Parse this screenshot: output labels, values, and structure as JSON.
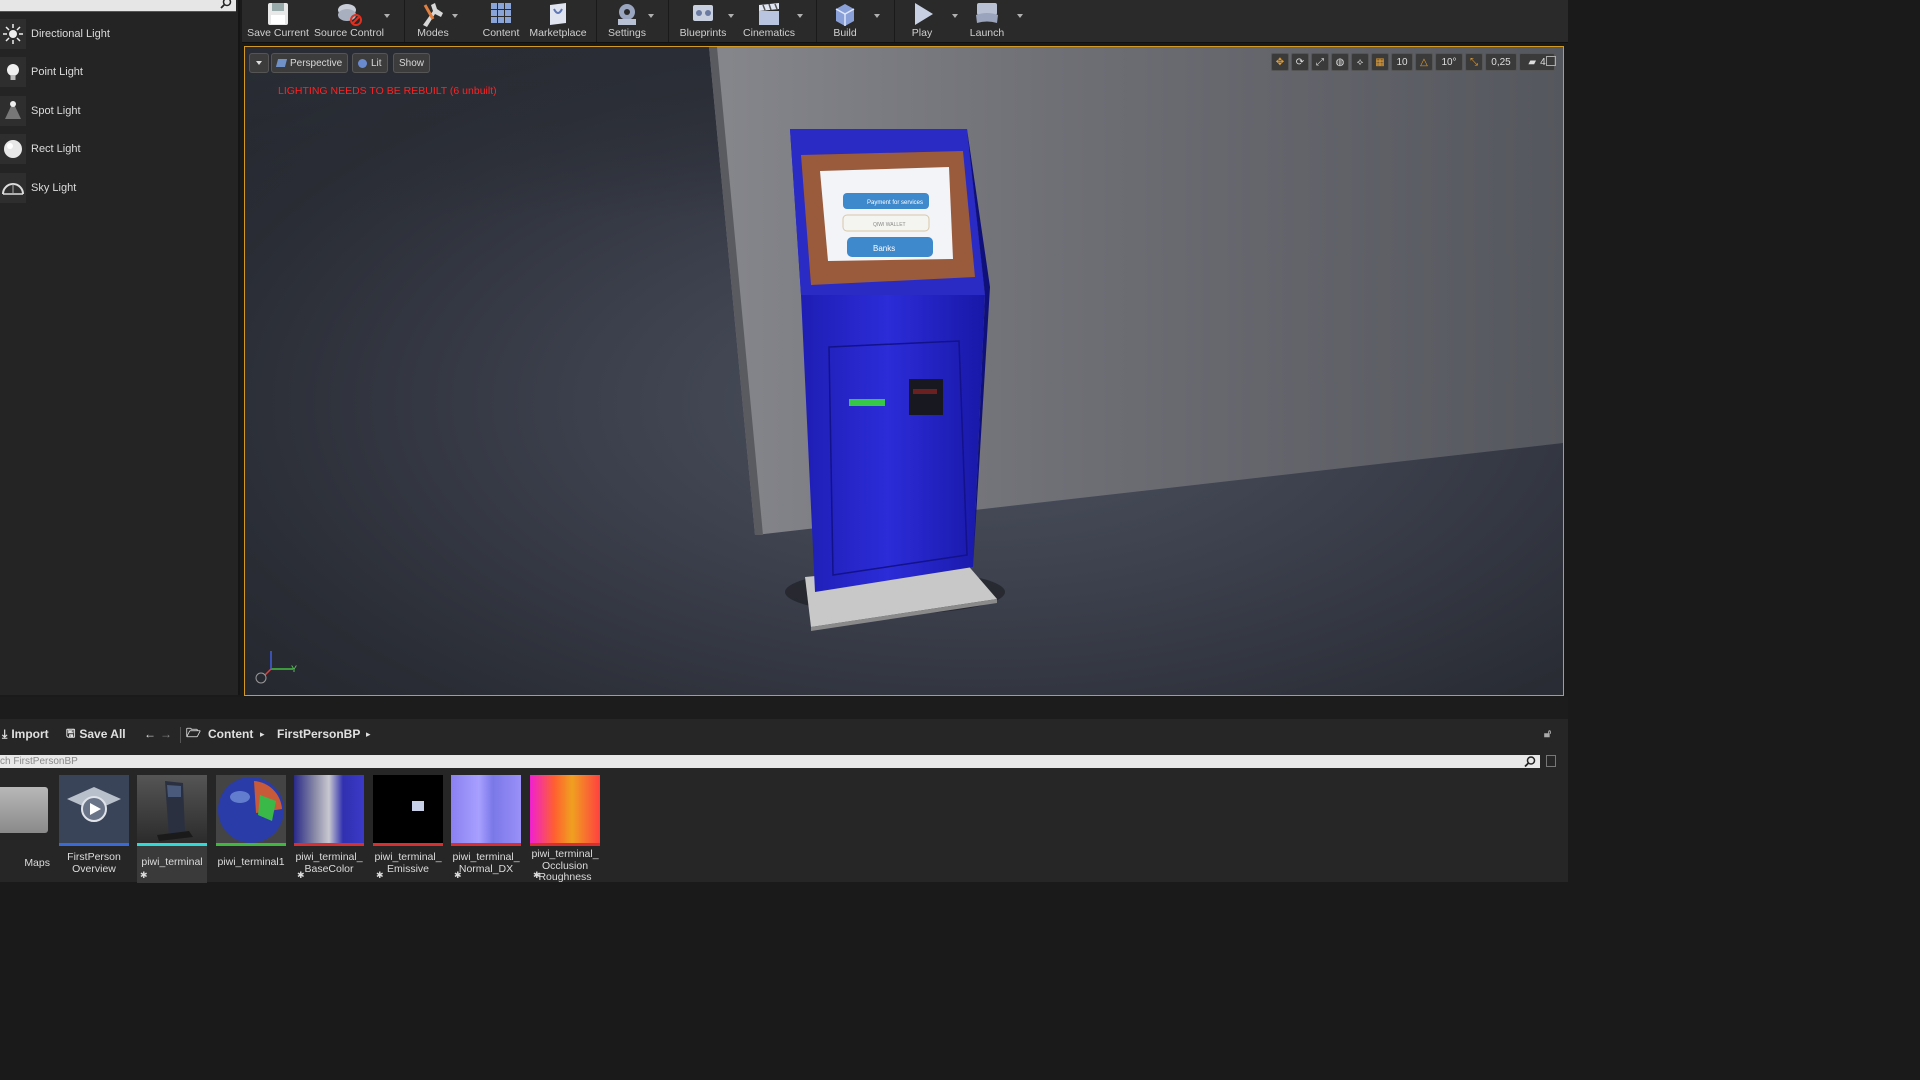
{
  "left_panel": {
    "items": [
      {
        "label": "Directional Light",
        "icon": "directional-light-icon"
      },
      {
        "label": "Point Light",
        "icon": "point-light-icon"
      },
      {
        "label": "Spot Light",
        "icon": "spot-light-icon"
      },
      {
        "label": "Rect Light",
        "icon": "rect-light-icon"
      },
      {
        "label": "Sky Light",
        "icon": "sky-light-icon"
      }
    ]
  },
  "toolbar": {
    "save_current": "Save Current",
    "source_control": "Source Control",
    "modes": "Modes",
    "content": "Content",
    "marketplace": "Marketplace",
    "settings": "Settings",
    "blueprints": "Blueprints",
    "cinematics": "Cinematics",
    "build": "Build",
    "play": "Play",
    "launch": "Launch"
  },
  "viewport": {
    "perspective": "Perspective",
    "lit": "Lit",
    "show": "Show",
    "warning": "LIGHTING NEEDS TO BE REBUILT (6 unbuilt)",
    "grid_snap": "10",
    "rotation_snap": "10°",
    "scale_snap": "0,25",
    "camera_speed": "4",
    "axis_y": "Y",
    "screen_lines": [
      "Payment for services",
      "QIWI WALLET",
      "Banks"
    ]
  },
  "content_browser": {
    "import": "Import",
    "save_all": "Save All",
    "breadcrumb": [
      "Content",
      "FirstPersonBP"
    ],
    "search_placeholder": "ch FirstPersonBP",
    "assets": [
      {
        "name": "Maps"
      },
      {
        "name": "FirstPerson Overview"
      },
      {
        "name": "piwi_terminal"
      },
      {
        "name": "piwi_terminal1"
      },
      {
        "name": "piwi_terminal_ BaseColor"
      },
      {
        "name": "piwi_terminal_ Emissive"
      },
      {
        "name": "piwi_terminal_ Normal_DX"
      },
      {
        "name": "piwi_terminal_ Occlusion Roughness"
      }
    ]
  },
  "colors": {
    "accent": "#d29a24",
    "warning": "#ff2222",
    "terminal_blue": "#2a2ad6"
  }
}
